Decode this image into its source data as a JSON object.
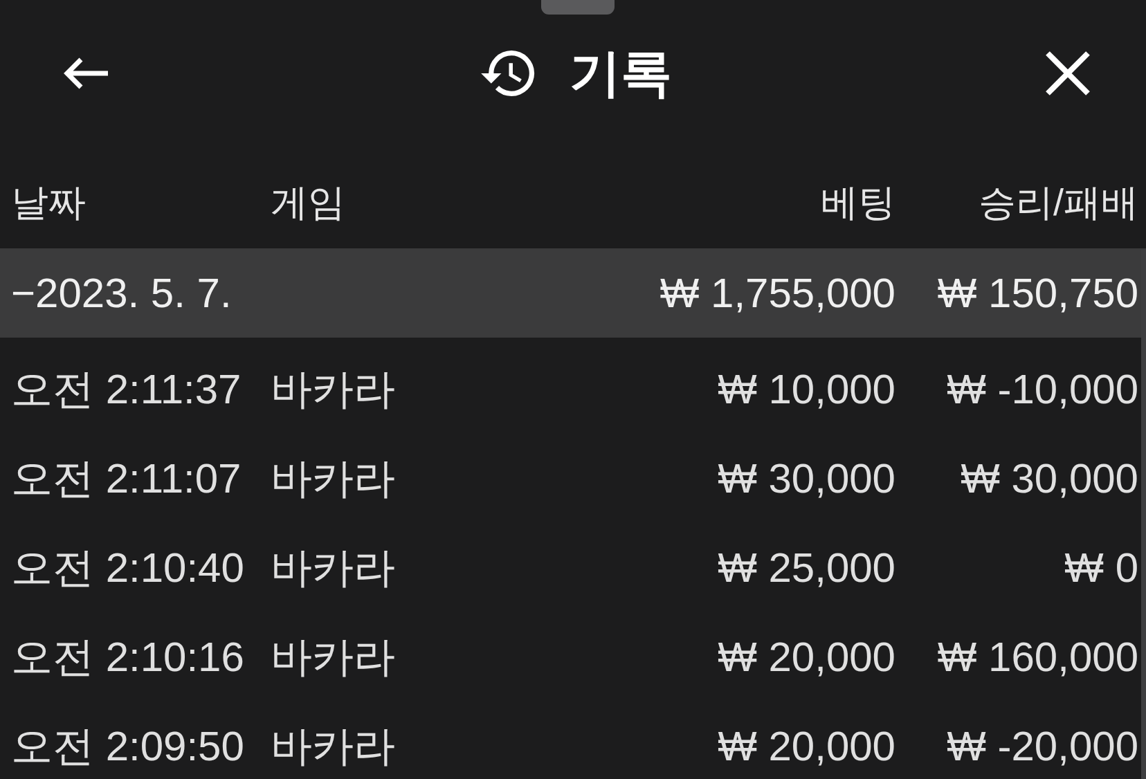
{
  "header": {
    "title": "기록"
  },
  "table": {
    "columns": [
      "날짜",
      "게임",
      "베팅",
      "승리/패배"
    ],
    "groups": [
      {
        "toggle": "−",
        "date": "2023. 5. 7.",
        "bet_total": "₩ 1,755,000",
        "result_total": "₩ 150,750",
        "rows": [
          {
            "time": "오전 2:11:37",
            "game": "바카라",
            "bet": "₩ 10,000",
            "result": "₩ -10,000"
          },
          {
            "time": "오전 2:11:07",
            "game": "바카라",
            "bet": "₩ 30,000",
            "result": "₩ 30,000"
          },
          {
            "time": "오전 2:10:40",
            "game": "바카라",
            "bet": "₩ 25,000",
            "result": "₩ 0"
          },
          {
            "time": "오전 2:10:16",
            "game": "바카라",
            "bet": "₩ 20,000",
            "result": "₩ 160,000"
          },
          {
            "time": "오전 2:09:50",
            "game": "바카라",
            "bet": "₩ 20,000",
            "result": "₩ -20,000"
          }
        ]
      }
    ]
  }
}
